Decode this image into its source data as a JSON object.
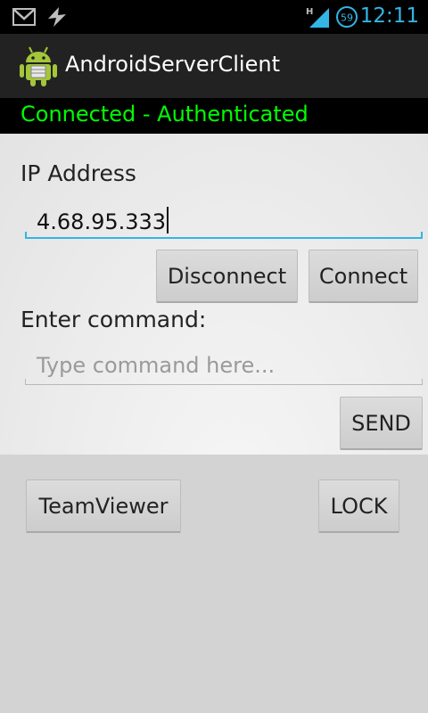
{
  "statusbar": {
    "time": "12:11",
    "icons": [
      "gmail-icon",
      "usb-debug-icon",
      "hspa-signal-icon",
      "battery-59-icon"
    ],
    "battery_level": "59",
    "network_type": "H"
  },
  "actionbar": {
    "title": "AndroidServerClient",
    "icon": "android-logo-icon"
  },
  "connection": {
    "status": "Connected - Authenticated",
    "color": "#00ff00"
  },
  "form": {
    "ip_label": "IP Address",
    "ip_value": "4.68.95.333",
    "disconnect_label": "Disconnect",
    "connect_label": "Connect",
    "command_label": "Enter command:",
    "command_placeholder": "Type command here...",
    "send_label": "SEND"
  },
  "actions": {
    "teamviewer_label": "TeamViewer",
    "lock_label": "LOCK"
  },
  "colors": {
    "accent": "#33b5e5",
    "status_green": "#00ff00"
  }
}
